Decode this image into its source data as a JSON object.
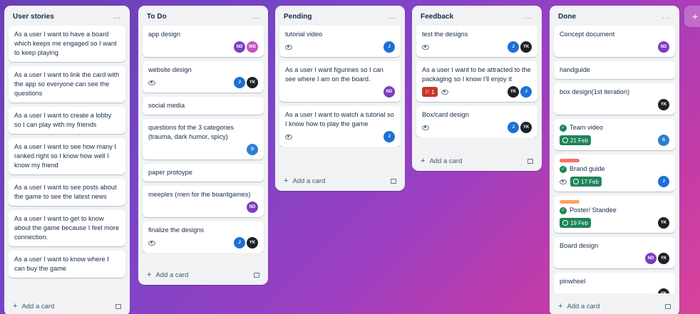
{
  "lists": {
    "stories": {
      "title": "User stories",
      "menu": "...",
      "add": "Add a card",
      "cards": [
        "As a user I want to have a board which keeps me engaged so I want to keep playing",
        "As a user I want to link the card with the app so everyone can see the questions",
        "As a user I want to create a lobby so I can play with my friends",
        "As a user I want to see how many I ranked right so I know how well I know my friend",
        "As a user I want to see posts about the game to see the latest news",
        "As a user I want to get to know about the game because I feel more connection.",
        "As a user I want to know where I can buy the game"
      ]
    },
    "todo": {
      "title": "To Do",
      "menu": "...",
      "add": "Add a card",
      "cards": [
        "app design",
        "website design",
        "social media",
        "questions fot the 3 categories (trauma, dark humor, spicy)",
        "paper protoype",
        "meeples (men for the boardgames)",
        "finalize the designs"
      ]
    },
    "pending": {
      "title": "Pending",
      "menu": "...",
      "add": "Add a card",
      "cards": [
        "tutorial video",
        "As a user I want figurines so I can see where I am on the board.",
        "As a user I want to watch a tutorial so I know how to play the game"
      ]
    },
    "feedback": {
      "title": "Feedback",
      "menu": "...",
      "add": "Add a card",
      "cards": [
        "test the designs",
        "As a user I want to be attracted to the packaging so I know I'll enjoy it",
        "Box/card design"
      ],
      "badge_count": "1"
    },
    "done": {
      "title": "Done",
      "menu": "...",
      "add": "Add a card",
      "cards": [
        "Concept document",
        "handguide",
        "box design(1st iteration)",
        "Team video",
        "Brand guide",
        "Poster/ Standee",
        "Board design",
        "pinwheel"
      ],
      "dates": [
        "21 Feb",
        "17 Feb",
        "19 Feb"
      ],
      "label_colors": {
        "brand": "#f87168",
        "poster": "#fea362"
      }
    }
  },
  "avatars": {
    "nd": "ND",
    "wd": "WD",
    "j": "J",
    "yk": "YK",
    "s": "S"
  },
  "add_list": "+"
}
